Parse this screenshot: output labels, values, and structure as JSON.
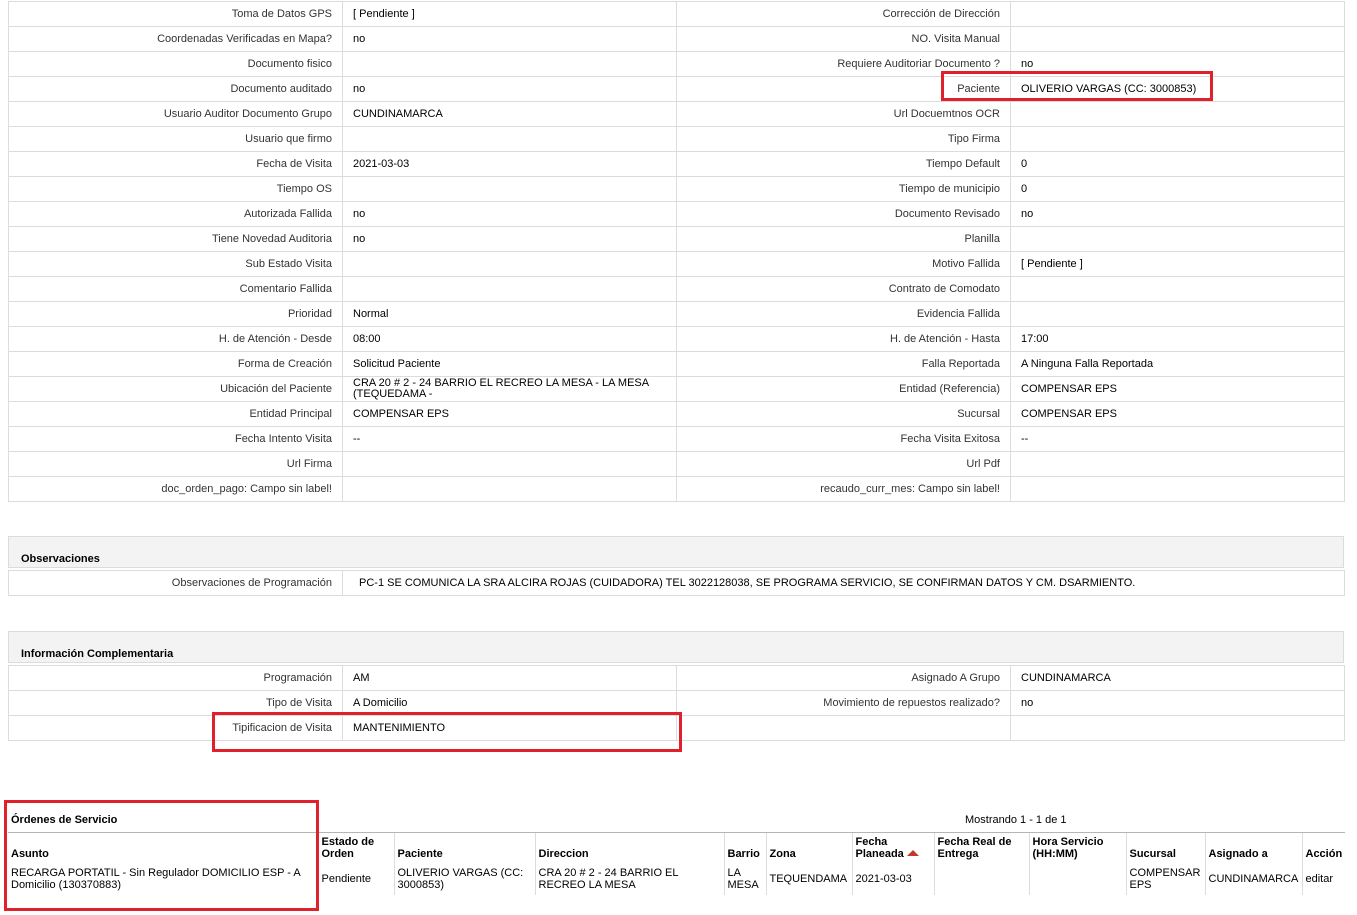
{
  "details": {
    "rows": [
      [
        "Toma de Datos GPS",
        "[ Pendiente ]",
        "Corrección de Dirección",
        ""
      ],
      [
        "Coordenadas Verificadas en Mapa?",
        " no",
        "NO. Visita Manual",
        ""
      ],
      [
        "Documento fisico",
        "",
        "Requiere Auditoriar Documento ?",
        " no"
      ],
      [
        "Documento auditado",
        " no",
        "Paciente",
        "OLIVERIO VARGAS (CC: 3000853)"
      ],
      [
        "Usuario Auditor Documento Grupo",
        "CUNDINAMARCA",
        "Url Docuemtnos OCR",
        ""
      ],
      [
        "Usuario que firmo",
        "",
        "Tipo Firma",
        ""
      ],
      [
        "Fecha de Visita",
        " 2021-03-03",
        "Tiempo Default",
        "0"
      ],
      [
        "Tiempo OS",
        "",
        "Tiempo de municipio",
        "0"
      ],
      [
        "Autorizada Fallida",
        " no",
        "Documento Revisado",
        " no"
      ],
      [
        "Tiene Novedad Auditoria",
        " no",
        "Planilla",
        ""
      ],
      [
        "Sub Estado Visita",
        "",
        "Motivo Fallida",
        "[ Pendiente ]"
      ],
      [
        "Comentario Fallida",
        "",
        "Contrato de Comodato",
        ""
      ],
      [
        "Prioridad",
        "Normal",
        "Evidencia Fallida",
        ""
      ],
      [
        "H. de Atención - Desde",
        "08:00",
        "H. de Atención - Hasta",
        "17:00"
      ],
      [
        "Forma de Creación",
        "Solicitud Paciente",
        "Falla Reportada",
        "A Ninguna Falla Reportada"
      ],
      [
        "Ubicación del Paciente",
        "CRA 20 # 2 - 24 BARRIO EL RECREO LA MESA - LA MESA (TEQUEDAMA -",
        "Entidad (Referencia)",
        "COMPENSAR EPS"
      ],
      [
        "Entidad Principal",
        "COMPENSAR EPS",
        "Sucursal",
        "COMPENSAR EPS"
      ],
      [
        "Fecha Intento Visita",
        " --",
        "Fecha Visita Exitosa",
        " --"
      ],
      [
        "Url Firma",
        "",
        "Url Pdf",
        ""
      ],
      [
        "doc_orden_pago: Campo sin label!",
        "",
        "recaudo_curr_mes: Campo sin label!",
        ""
      ]
    ]
  },
  "observaciones": {
    "title": "Observaciones",
    "label": "Observaciones de Programación",
    "value": "PC-1 SE COMUNICA LA SRA ALCIRA ROJAS (CUIDADORA) TEL 3022128038, SE PROGRAMA SERVICIO, SE CONFIRMAN DATOS Y CM. DSARMIENTO."
  },
  "complementaria": {
    "title": "Información Complementaria",
    "rows": [
      [
        "Programación",
        "AM",
        "Asignado A Grupo",
        "CUNDINAMARCA"
      ],
      [
        "Tipo de Visita",
        "A Domicilio",
        "Movimiento de repuestos realizado?",
        " no"
      ],
      [
        "Tipificacion de Visita",
        "MANTENIMIENTO",
        "",
        ""
      ]
    ]
  },
  "ordenes": {
    "title": "Órdenes de Servicio",
    "count": "Mostrando 1 - 1 de 1",
    "columns": [
      "Asunto",
      "Estado de Orden",
      "Paciente",
      "Direccion",
      "Barrio",
      "Zona",
      "Fecha Planeada",
      "Fecha Real de Entrega",
      "Hora Servicio (HH:MM)",
      "Sucursal",
      "Asignado a",
      "Acción"
    ],
    "row": {
      "asunto": "RECARGA PORTATIL - Sin Regulador DOMICILIO ESP - A Domicilio (130370883)",
      "estado": "Pendiente",
      "paciente": "OLIVERIO VARGAS (CC: 3000853)",
      "direccion": "CRA 20 # 2 - 24 BARRIO EL RECREO LA MESA",
      "barrio": "LA MESA",
      "zona": "TEQUENDAMA",
      "fecha_planeada": "2021-03-03",
      "fecha_real": "",
      "hora": "",
      "sucursal": "COMPENSAR EPS",
      "asignado": "CUNDINAMARCA",
      "accion": "editar"
    }
  },
  "colors": {
    "highlight": "#e0202a",
    "section_bg": "#f3f3f3",
    "border": "#dcdcdc"
  }
}
